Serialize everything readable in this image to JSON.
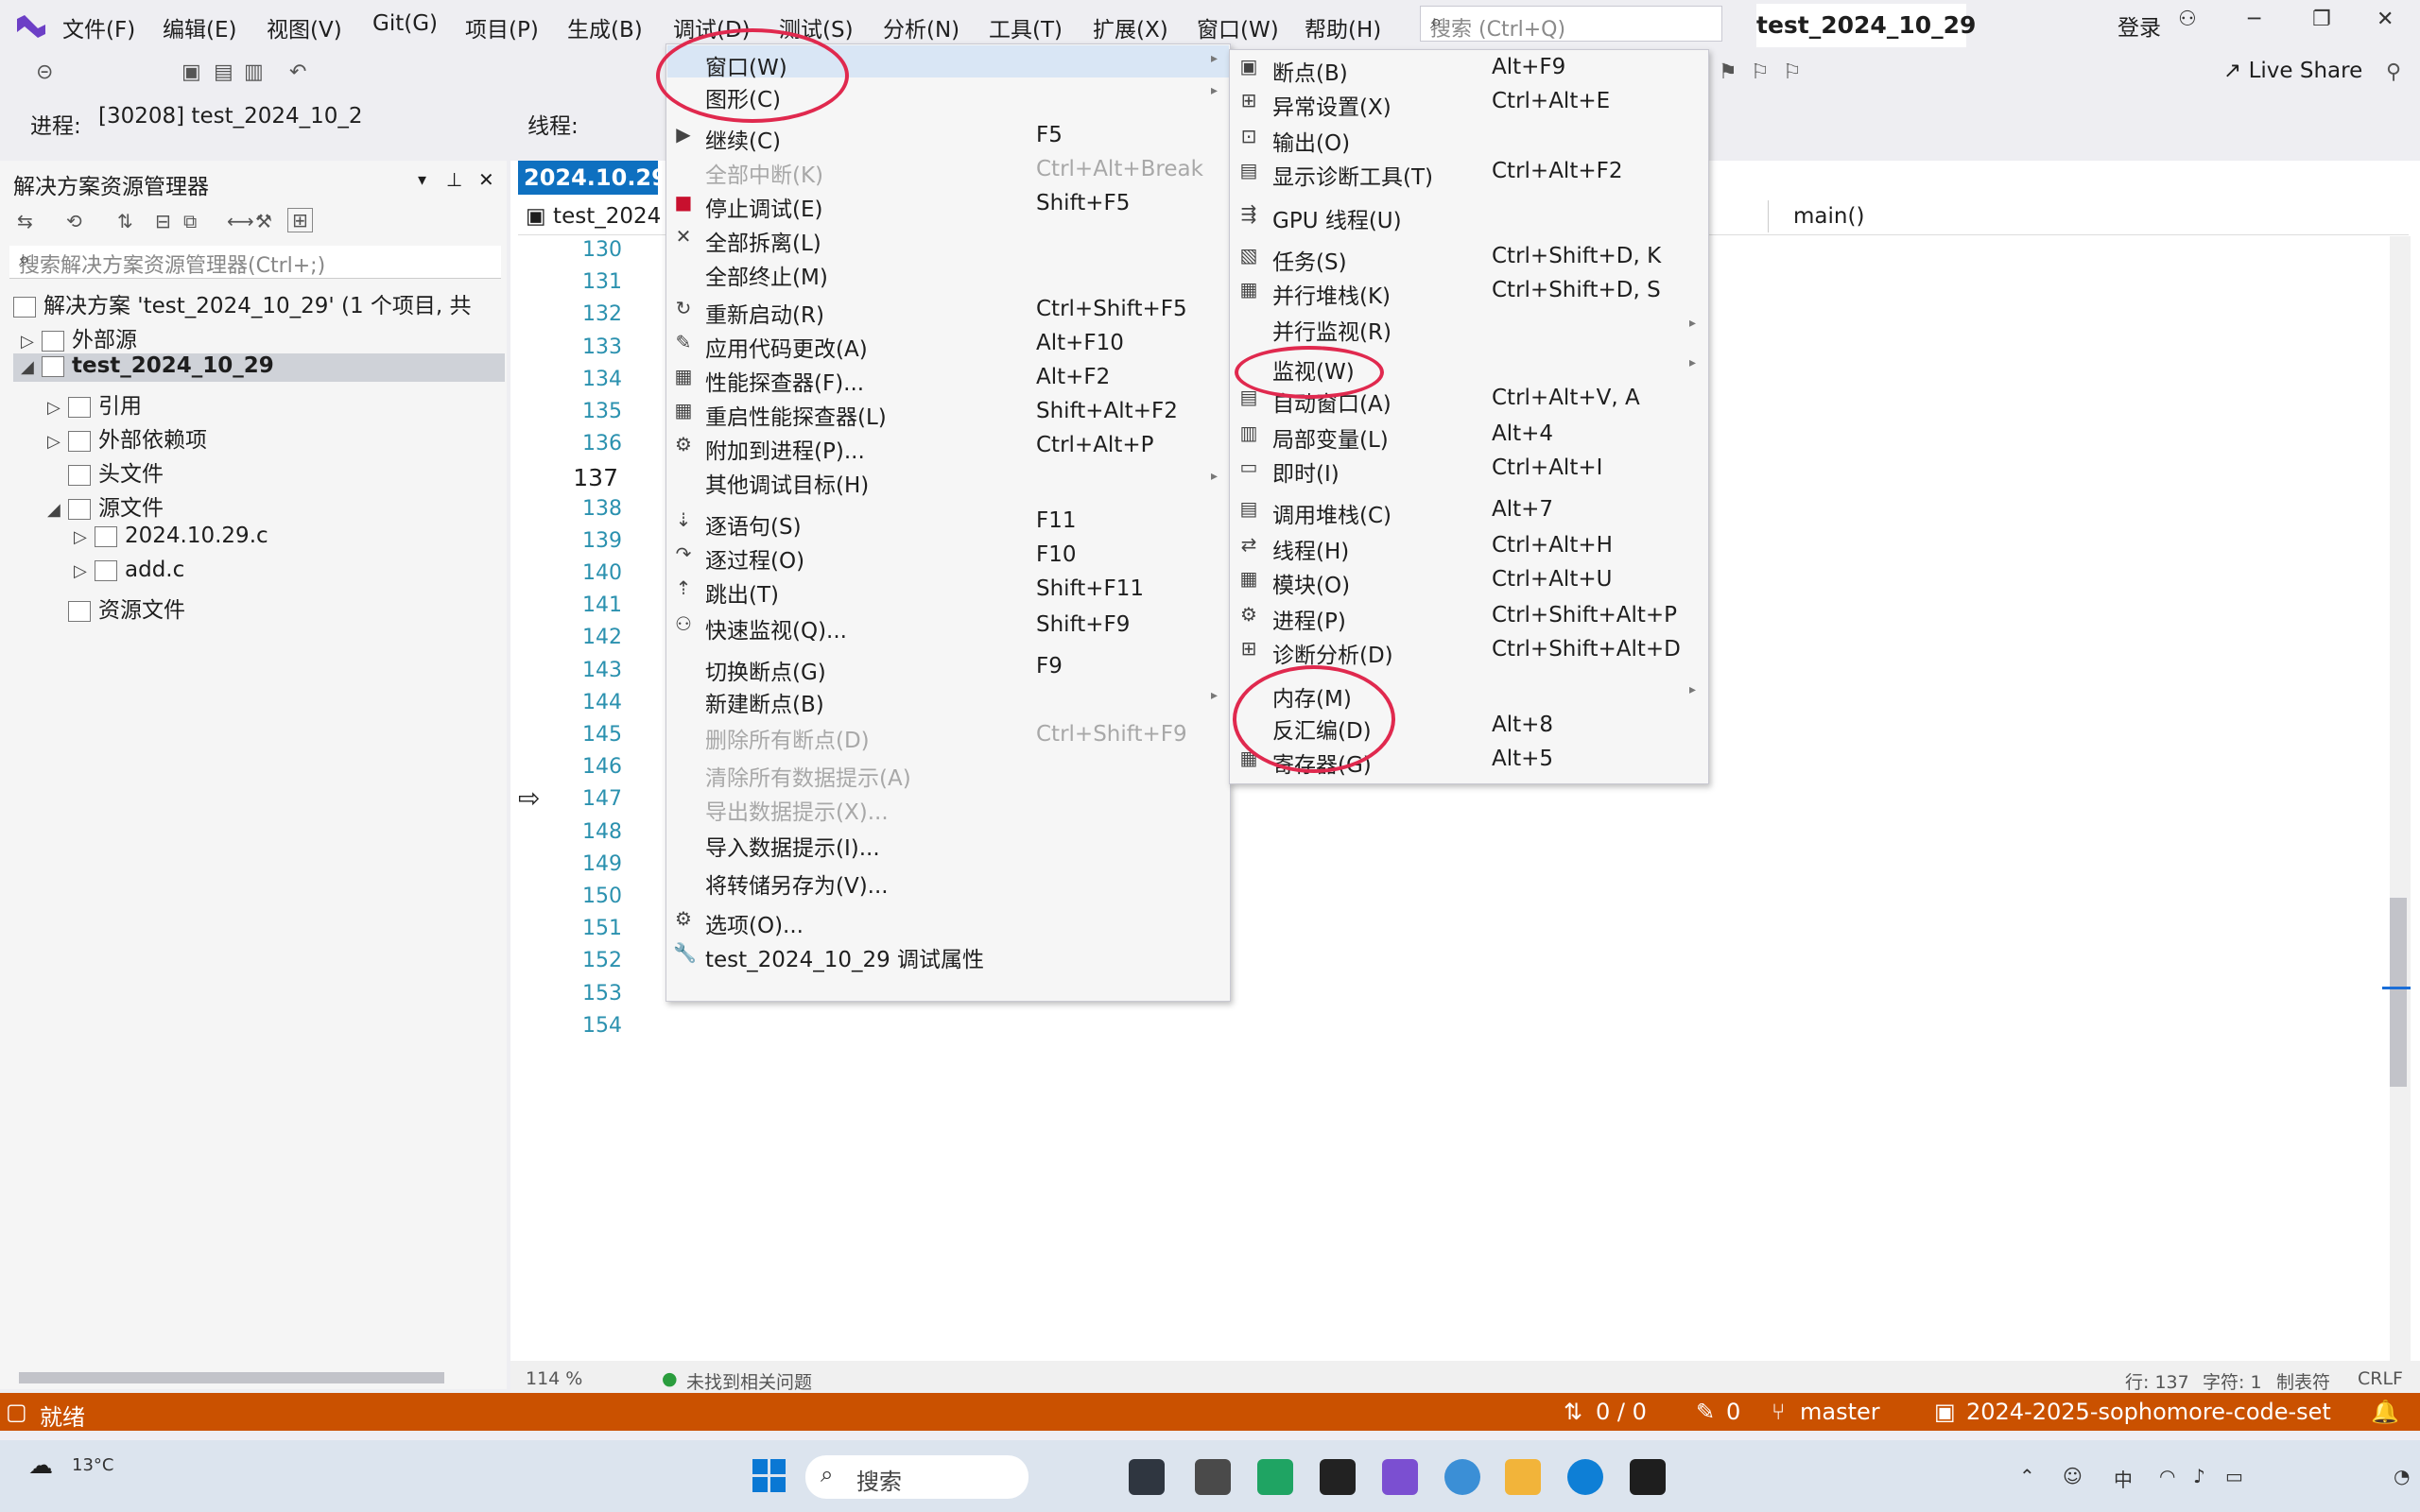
{
  "menubar": {
    "items": [
      "文件(F)",
      "编辑(E)",
      "视图(V)",
      "Git(G)",
      "项目(P)",
      "生成(B)",
      "调试(D)",
      "测试(S)",
      "分析(N)",
      "工具(T)",
      "扩展(X)",
      "窗口(W)",
      "帮助(H)"
    ],
    "search_placeholder": "搜索 (Ctrl+Q)",
    "solution_name": "test_2024_10_29",
    "login": "登录"
  },
  "toolbar": {
    "live_share": "Live Share",
    "process_label": "进程:",
    "process_value": "[30208] test_2024_10_2",
    "thread_label": "线程:"
  },
  "solution_explorer": {
    "title": "解决方案资源管理器",
    "search_placeholder": "搜索解决方案资源管理器(Ctrl+;)",
    "tree": [
      "解决方案 'test_2024_10_29' (1 个项目, 共",
      "外部源",
      "test_2024_10_29",
      "引用",
      "外部依赖项",
      "头文件",
      "源文件",
      "2024.10.29.c",
      "add.c",
      "资源文件"
    ]
  },
  "editor": {
    "tab_label": "2024.10.29.",
    "file_combo": "test_2024",
    "function_combo": "main()",
    "line_numbers": [
      "130",
      "131",
      "132",
      "133",
      "134",
      "135",
      "136",
      "137",
      "138",
      "139",
      "140",
      "141",
      "142",
      "143",
      "144",
      "145",
      "146",
      "147",
      "148",
      "149",
      "150",
      "151",
      "152",
      "153",
      "154"
    ],
    "current_line": "137",
    "zoom": "114 %",
    "issues": "未找到相关问题",
    "position": "行: 137",
    "char": "字符: 1",
    "tabs_mode": "制表符",
    "eol": "CRLF"
  },
  "debug_menu": {
    "items": [
      {
        "label": "窗口(W)",
        "shortcut": "",
        "submenu": true,
        "disabled": false
      },
      {
        "label": "图形(C)",
        "shortcut": "",
        "submenu": true,
        "disabled": false
      },
      {
        "label": "继续(C)",
        "shortcut": "F5",
        "disabled": false
      },
      {
        "label": "全部中断(K)",
        "shortcut": "Ctrl+Alt+Break",
        "disabled": true
      },
      {
        "label": "停止调试(E)",
        "shortcut": "Shift+F5",
        "disabled": false
      },
      {
        "label": "全部拆离(L)",
        "shortcut": "",
        "disabled": false
      },
      {
        "label": "全部终止(M)",
        "shortcut": "",
        "disabled": false
      },
      {
        "label": "重新启动(R)",
        "shortcut": "Ctrl+Shift+F5",
        "disabled": false
      },
      {
        "label": "应用代码更改(A)",
        "shortcut": "Alt+F10",
        "disabled": false
      },
      {
        "label": "性能探查器(F)...",
        "shortcut": "Alt+F2",
        "disabled": false
      },
      {
        "label": "重启性能探查器(L)",
        "shortcut": "Shift+Alt+F2",
        "disabled": false
      },
      {
        "label": "附加到进程(P)...",
        "shortcut": "Ctrl+Alt+P",
        "disabled": false
      },
      {
        "label": "其他调试目标(H)",
        "shortcut": "",
        "submenu": true,
        "disabled": false
      },
      {
        "label": "逐语句(S)",
        "shortcut": "F11",
        "disabled": false
      },
      {
        "label": "逐过程(O)",
        "shortcut": "F10",
        "disabled": false
      },
      {
        "label": "跳出(T)",
        "shortcut": "Shift+F11",
        "disabled": false
      },
      {
        "label": "快速监视(Q)...",
        "shortcut": "Shift+F9",
        "disabled": false
      },
      {
        "label": "切换断点(G)",
        "shortcut": "F9",
        "disabled": false
      },
      {
        "label": "新建断点(B)",
        "shortcut": "",
        "submenu": true,
        "disabled": false
      },
      {
        "label": "删除所有断点(D)",
        "shortcut": "Ctrl+Shift+F9",
        "disabled": true
      },
      {
        "label": "清除所有数据提示(A)",
        "shortcut": "",
        "disabled": true
      },
      {
        "label": "导出数据提示(X)...",
        "shortcut": "",
        "disabled": true
      },
      {
        "label": "导入数据提示(I)...",
        "shortcut": "",
        "disabled": false
      },
      {
        "label": "将转储另存为(V)...",
        "shortcut": "",
        "disabled": false
      },
      {
        "label": "选项(O)...",
        "shortcut": "",
        "disabled": false
      },
      {
        "label": "test_2024_10_29 调试属性",
        "shortcut": "",
        "disabled": false
      }
    ]
  },
  "window_submenu": {
    "items": [
      {
        "label": "断点(B)",
        "shortcut": "Alt+F9"
      },
      {
        "label": "异常设置(X)",
        "shortcut": "Ctrl+Alt+E"
      },
      {
        "label": "输出(O)",
        "shortcut": ""
      },
      {
        "label": "显示诊断工具(T)",
        "shortcut": "Ctrl+Alt+F2"
      },
      {
        "label": "GPU 线程(U)",
        "shortcut": ""
      },
      {
        "label": "任务(S)",
        "shortcut": "Ctrl+Shift+D, K"
      },
      {
        "label": "并行堆栈(K)",
        "shortcut": "Ctrl+Shift+D, S"
      },
      {
        "label": "并行监视(R)",
        "shortcut": "",
        "submenu": true
      },
      {
        "label": "监视(W)",
        "shortcut": "",
        "submenu": true
      },
      {
        "label": "自动窗口(A)",
        "shortcut": "Ctrl+Alt+V, A"
      },
      {
        "label": "局部变量(L)",
        "shortcut": "Alt+4"
      },
      {
        "label": "即时(I)",
        "shortcut": "Ctrl+Alt+I"
      },
      {
        "label": "调用堆栈(C)",
        "shortcut": "Alt+7"
      },
      {
        "label": "线程(H)",
        "shortcut": "Ctrl+Alt+H"
      },
      {
        "label": "模块(O)",
        "shortcut": "Ctrl+Alt+U"
      },
      {
        "label": "进程(P)",
        "shortcut": "Ctrl+Shift+Alt+P"
      },
      {
        "label": "诊断分析(D)",
        "shortcut": "Ctrl+Shift+Alt+D"
      },
      {
        "label": "内存(M)",
        "shortcut": "",
        "submenu": true
      },
      {
        "label": "反汇编(D)",
        "shortcut": "Alt+8"
      },
      {
        "label": "寄存器(G)",
        "shortcut": "Alt+5"
      }
    ]
  },
  "statusbar": {
    "ready": "就绪",
    "errors": "0 / 0",
    "pencil": "0",
    "branch": "master",
    "repo": "2024-2025-sophomore-code-set"
  },
  "taskbar": {
    "weather": "13°C",
    "search": "搜索"
  },
  "colors": {
    "accent": "#0e70c0",
    "statusbar": "#ca5100",
    "annotation_circle": "#e0294e"
  }
}
